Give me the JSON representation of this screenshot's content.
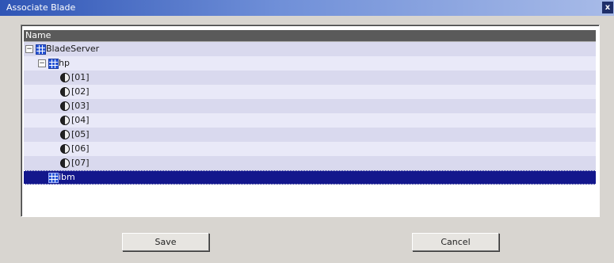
{
  "window": {
    "title": "Associate Blade"
  },
  "table": {
    "header": "Name"
  },
  "tree": [
    {
      "label": "BladeServer",
      "icon": "grid-icon",
      "expander": "−"
    },
    {
      "label": "hp",
      "icon": "grid-icon",
      "expander": "−"
    },
    {
      "label": "[01]",
      "icon": "blade-icon"
    },
    {
      "label": "[02]",
      "icon": "blade-icon"
    },
    {
      "label": "[03]",
      "icon": "blade-icon"
    },
    {
      "label": "[04]",
      "icon": "blade-icon"
    },
    {
      "label": "[05]",
      "icon": "blade-icon"
    },
    {
      "label": "[06]",
      "icon": "blade-icon"
    },
    {
      "label": "[07]",
      "icon": "blade-icon"
    },
    {
      "label": "ibm",
      "icon": "grid-icon",
      "selected": true
    }
  ],
  "buttons": {
    "save": "Save",
    "cancel": "Cancel"
  },
  "colors": {
    "selection": "#13178c",
    "header": "#5a5a5a"
  }
}
